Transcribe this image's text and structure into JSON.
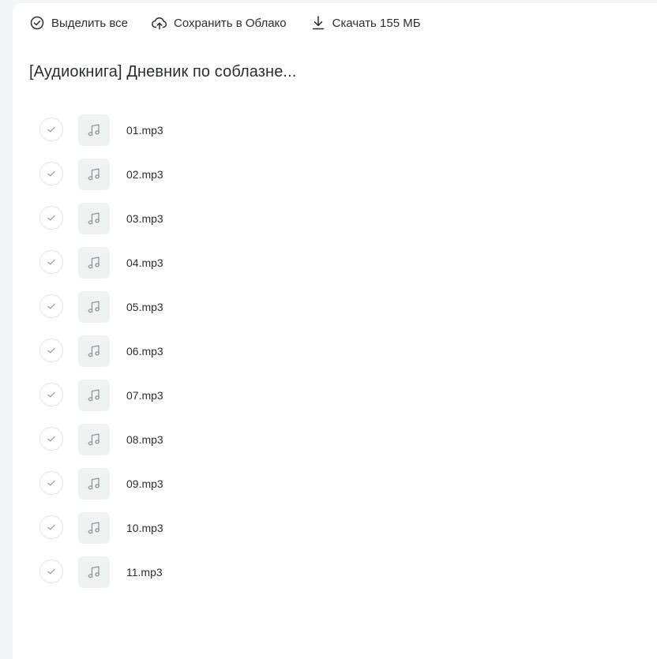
{
  "toolbar": {
    "select_all_label": "Выделить все",
    "save_cloud_label": "Сохранить в Облако",
    "download_label": "Скачать 155 МБ"
  },
  "folder_title": "[Аудиокнига] Дневник по соблазне...",
  "files": [
    {
      "name": "01.mp3",
      "icon": "music-note-icon"
    },
    {
      "name": "02.mp3",
      "icon": "music-note-icon"
    },
    {
      "name": "03.mp3",
      "icon": "music-note-icon"
    },
    {
      "name": "04.mp3",
      "icon": "music-note-icon"
    },
    {
      "name": "05.mp3",
      "icon": "music-note-icon"
    },
    {
      "name": "06.mp3",
      "icon": "music-note-icon"
    },
    {
      "name": "07.mp3",
      "icon": "music-note-icon"
    },
    {
      "name": "08.mp3",
      "icon": "music-note-icon"
    },
    {
      "name": "09.mp3",
      "icon": "music-note-icon"
    },
    {
      "name": "10.mp3",
      "icon": "music-note-icon"
    },
    {
      "name": "11.mp3",
      "icon": "music-note-icon"
    }
  ],
  "colors": {
    "text": "#2c2d2e",
    "icon_gray": "#8f9399",
    "thumb_bg": "#f0f1f3",
    "border": "#e4e6ea",
    "page_bg": "#f4f5f7"
  }
}
